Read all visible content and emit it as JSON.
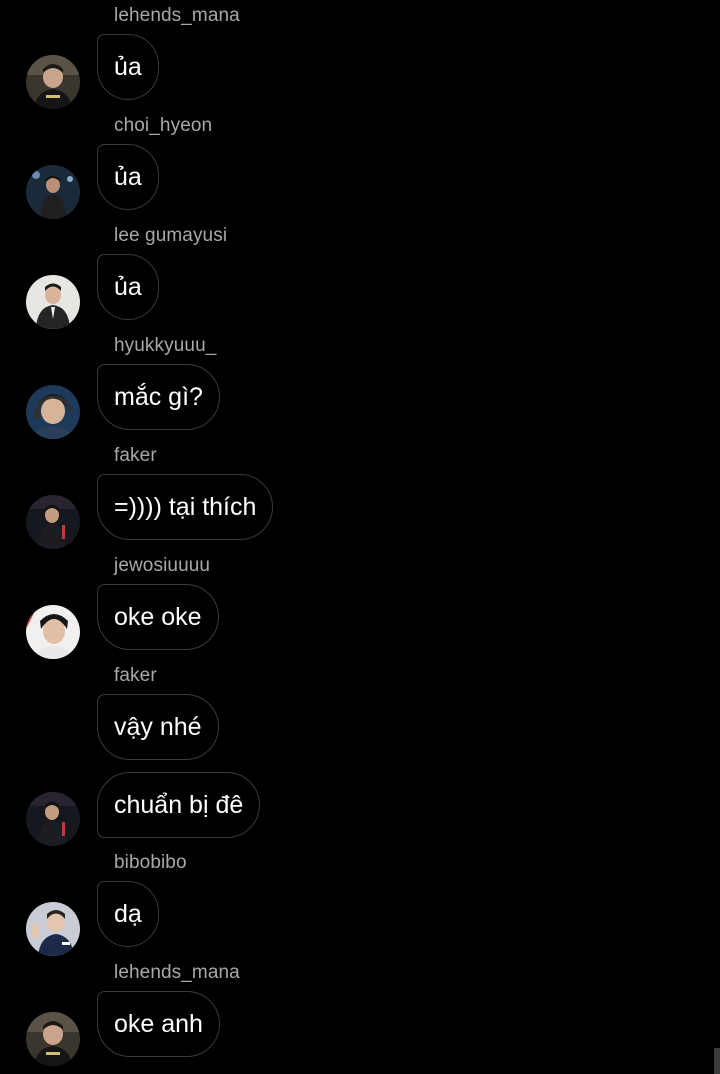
{
  "messages": [
    {
      "sender": "lehends_mana",
      "text": "ủa",
      "avatar": "avatar-lehends"
    },
    {
      "sender": "choi_hyeon",
      "text": "ủa",
      "avatar": "avatar-choi"
    },
    {
      "sender": "lee gumayusi",
      "text": "ủa",
      "avatar": "avatar-gumayusi"
    },
    {
      "sender": "hyukkyuuu_",
      "text": "mắc gì?",
      "avatar": "avatar-hyukkyu"
    },
    {
      "sender": "faker",
      "text": "=)))) tại thích",
      "avatar": "avatar-faker"
    },
    {
      "sender": "jewosiuuuu",
      "text": "oke oke",
      "avatar": "avatar-jewo"
    },
    {
      "sender": "faker",
      "text": "vậy nhé",
      "avatar": ""
    },
    {
      "sender": "",
      "text": "chuẩn bị đê",
      "avatar": "avatar-faker"
    },
    {
      "sender": "bibobibo",
      "text": "dạ",
      "avatar": "avatar-bibo"
    },
    {
      "sender": "lehends_mana",
      "text": "oke anh",
      "avatar": "avatar-lehends"
    }
  ],
  "colors": {
    "background": "#000000",
    "bubble_border": "#3a3a3a",
    "sender_text": "#a8a8a8",
    "message_text": "#ffffff"
  }
}
